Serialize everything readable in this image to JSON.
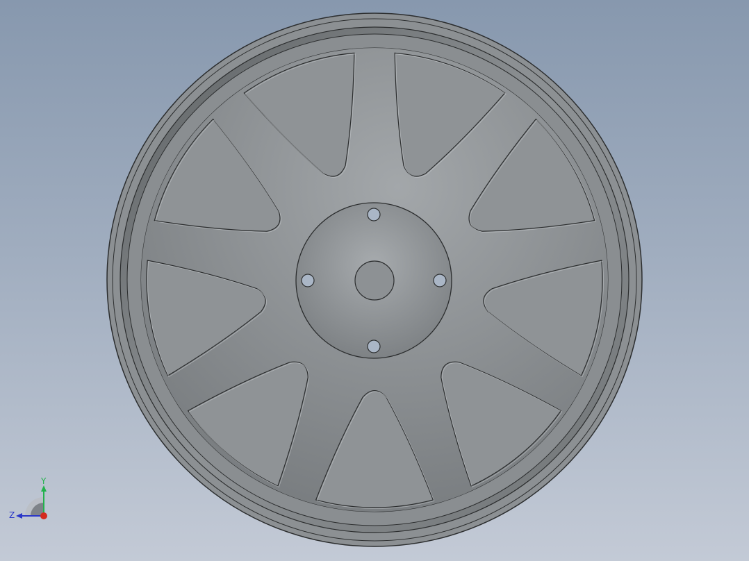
{
  "viewport": {
    "background_top": "#8798ae",
    "background_bottom": "#c3cad6"
  },
  "model": {
    "name": "wheel",
    "spoke_count": 9,
    "bolt_hole_count": 4,
    "colors": {
      "metal": "#8f9396",
      "edge": "#2b2d2e",
      "rim_dark": "#4e5152"
    }
  },
  "triad": {
    "x_label": "",
    "y_label": "Y",
    "z_label": "Z",
    "y_color": "#22b24c",
    "z_color": "#2a36c8",
    "x_color": "#d42a1e"
  }
}
